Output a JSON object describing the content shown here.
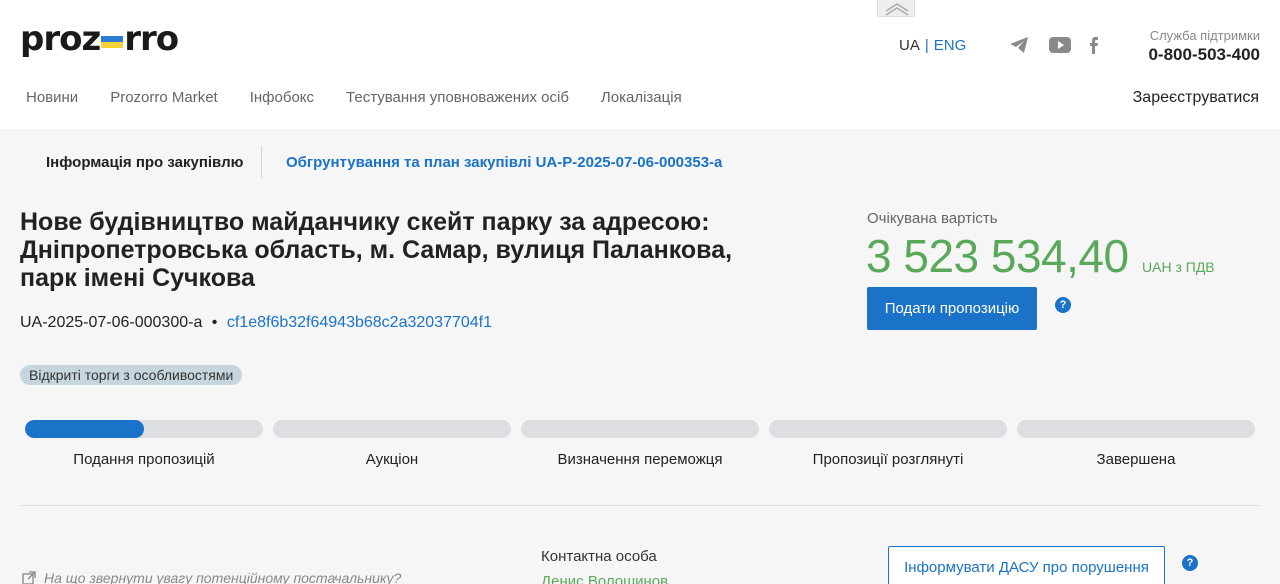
{
  "header": {
    "logo_left": "proz",
    "logo_right": "rro",
    "flag_colors": [
      "#2e7bd6",
      "#f6d23a"
    ],
    "lang_ua": "UA",
    "lang_sep": "|",
    "lang_eng": "ENG",
    "support_label": "Служба підтримки",
    "support_phone": "0-800-503-400",
    "social_icons": [
      "telegram-icon",
      "youtube-icon",
      "facebook-icon"
    ]
  },
  "nav": {
    "items": [
      "Новини",
      "Prozorro Market",
      "Інфобокс",
      "Тестування уповноважених осіб",
      "Локалізація"
    ],
    "register": "Зареєструватися"
  },
  "tabs": {
    "info": "Інформація про закупівлю",
    "plan": "Обгрунтування та план закупівлі UA-P-2025-07-06-000353-a"
  },
  "tender": {
    "title": "Нове будівництво майданчику скейт парку за адресою: Дніпропетровська область, м. Самар, вулиця Паланкова, парк імені Сучкова",
    "id": "UA-2025-07-06-000300-a",
    "bullet": "•",
    "hash": "cf1e8f6b32f64943b68c2a32037704f1",
    "type_badge": "Відкриті торги з особливостями"
  },
  "value": {
    "label": "Очікувана вартість",
    "amount": "3 523 534,40",
    "unit": "UAH з ПДВ",
    "submit_label": "Подати пропозицію",
    "help": "?"
  },
  "stages": [
    {
      "label": "Подання пропозицій",
      "progress": 0.5
    },
    {
      "label": "Аукціон",
      "progress": 0
    },
    {
      "label": "Визначення переможця",
      "progress": 0
    },
    {
      "label": "Пропозиції розглянуті",
      "progress": 0
    },
    {
      "label": "Завершена",
      "progress": 0
    }
  ],
  "bottom": {
    "note": "На що звернути увагу потенційному постачальнику?",
    "contact_label": "Контактна особа",
    "contact_name": "Денис Волошинов",
    "dasu_label": "Інформувати ДАСУ про порушення",
    "help": "?"
  },
  "colors": {
    "accent": "#1a73c9",
    "money": "#5aa95a"
  }
}
